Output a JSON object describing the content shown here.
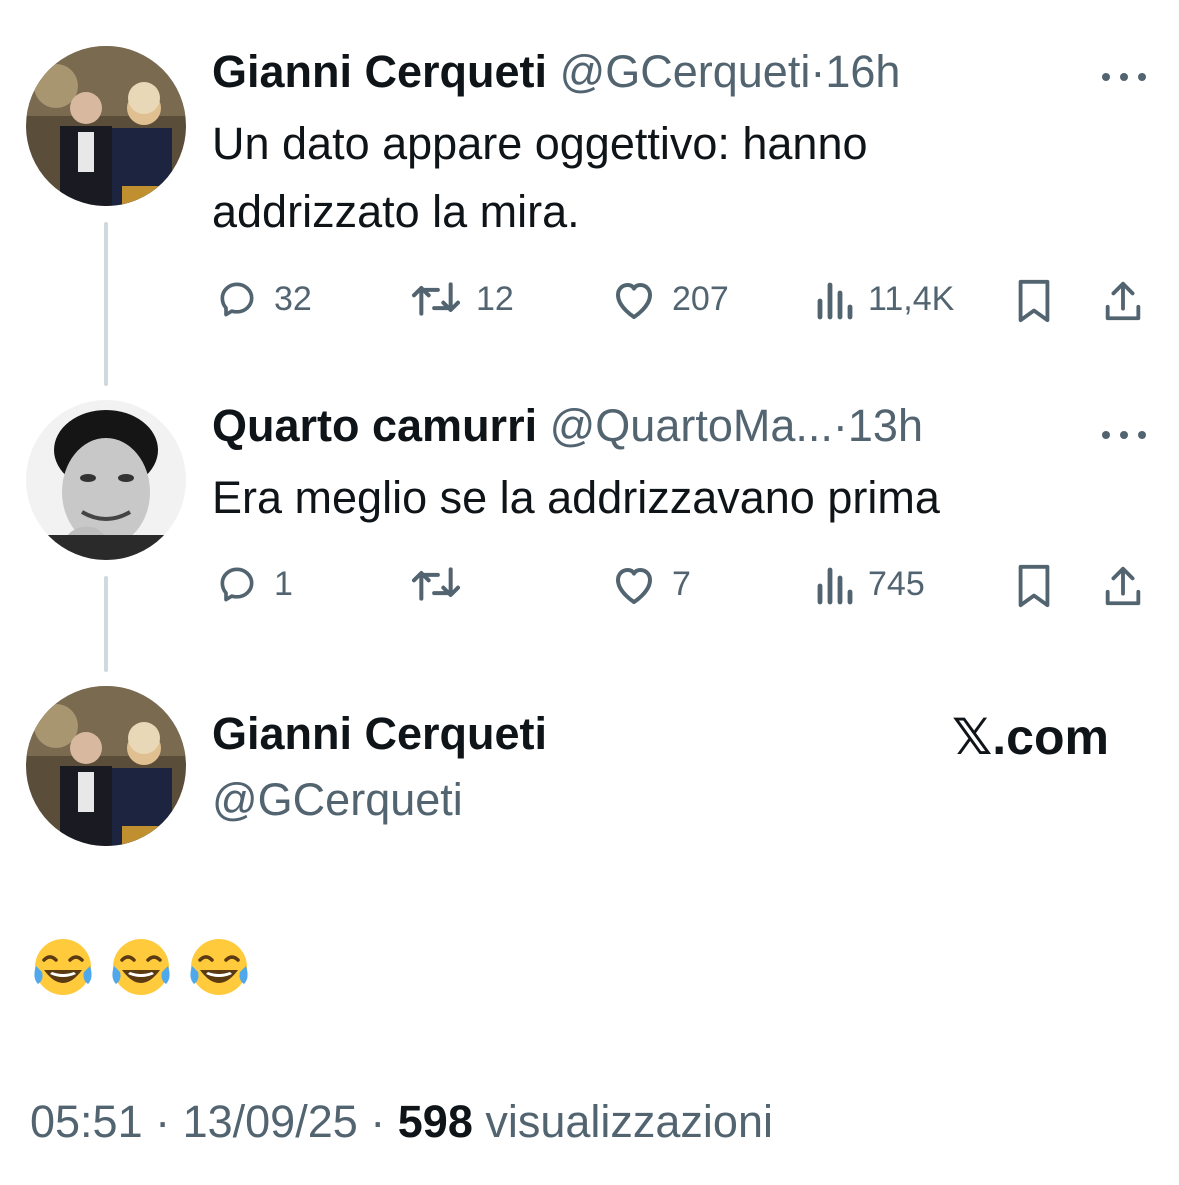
{
  "tweets": [
    {
      "name": "Gianni Cerqueti",
      "handle": "@GCerqueti",
      "sep": "·",
      "time": "16h",
      "text_line1": "Un dato appare oggettivo: hanno",
      "text_line2": "addrizzato la mira.",
      "replies": "32",
      "retweets": "12",
      "likes": "207",
      "views": "11,4K"
    },
    {
      "name": "Quarto camurri",
      "handle": "@QuartoMa...",
      "sep": "·",
      "time": "13h",
      "text_line1": "Era meglio se la addrizzavano prima",
      "replies": "1",
      "retweets": "",
      "likes": "7",
      "views": "745"
    }
  ],
  "main_tweet": {
    "name": "Gianni Cerqueti",
    "handle": "@GCerqueti",
    "brand": "𝕏.com",
    "footer_time": "05:51 · 13/09/25 · ",
    "footer_views": "598",
    "footer_views_label": " visualizzazioni"
  },
  "icons": {
    "reply": "reply-icon",
    "retweet": "retweet-icon",
    "like": "heart-icon",
    "views": "views-icon",
    "bookmark": "bookmark-icon",
    "share": "share-icon",
    "more": "more-icon",
    "emoji": "face-with-tears-of-joy-emoji"
  },
  "colors": {
    "text": "#0f1419",
    "secondary": "#536471",
    "thread_line": "#cfd9de"
  }
}
